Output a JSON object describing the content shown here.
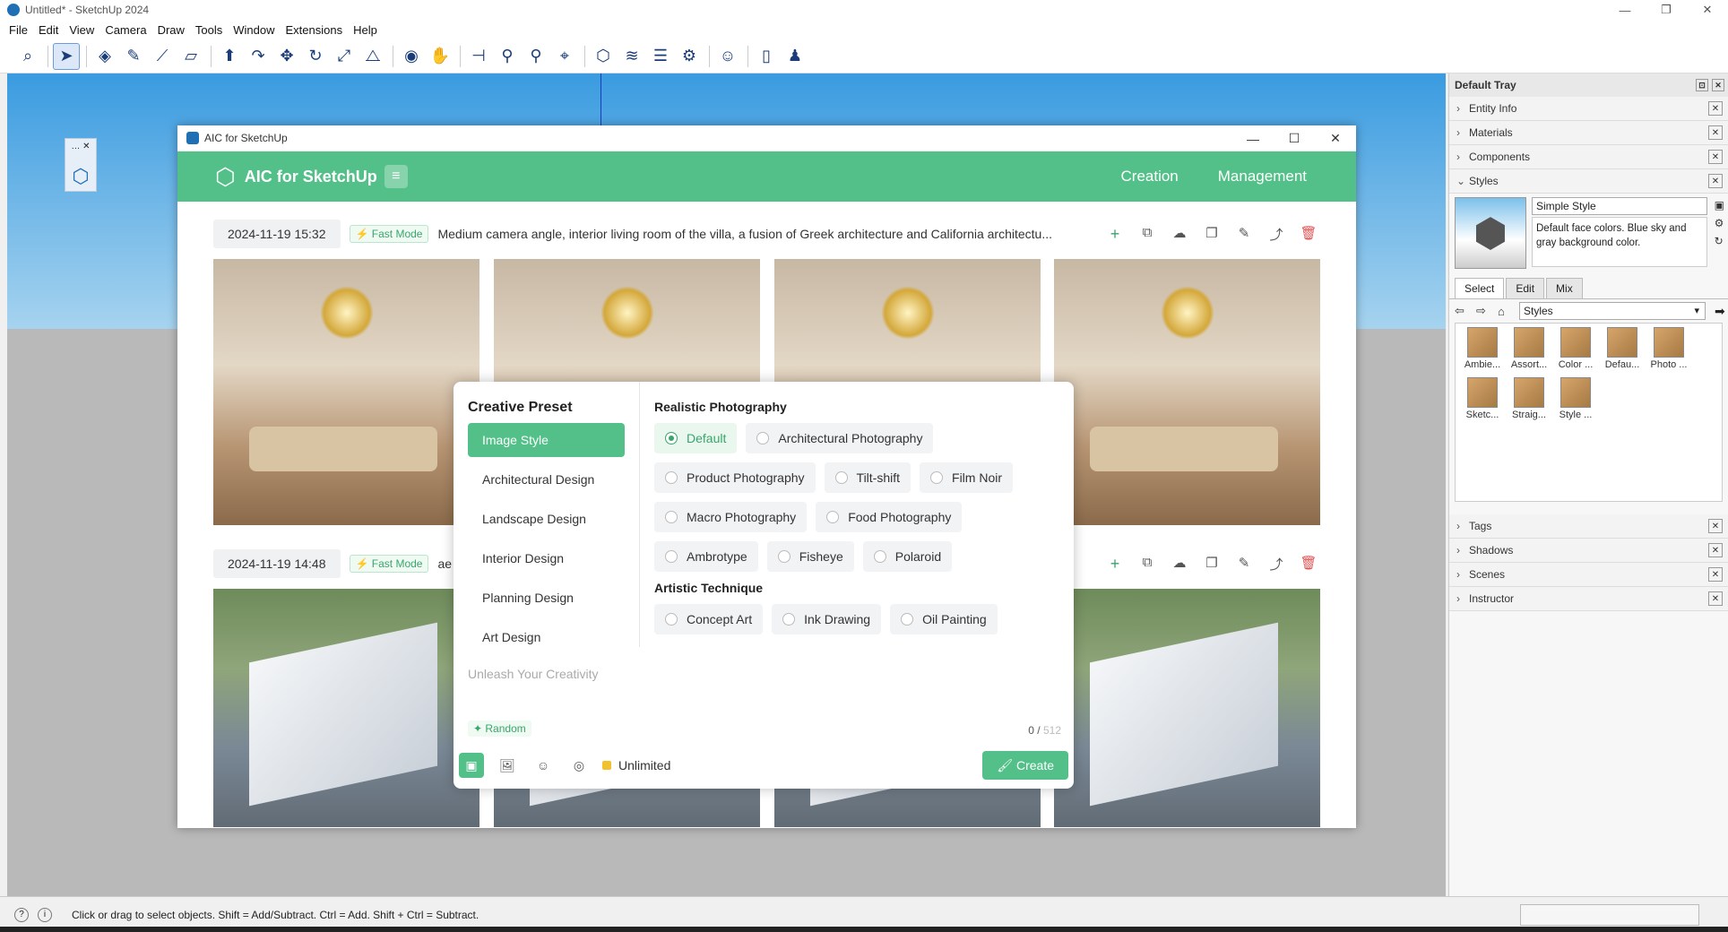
{
  "window": {
    "title": "Untitled* - SketchUp 2024",
    "minimize": "—",
    "restore": "❐",
    "close": "✕"
  },
  "menu": [
    "File",
    "Edit",
    "View",
    "Camera",
    "Draw",
    "Tools",
    "Window",
    "Extensions",
    "Help"
  ],
  "toolbar_icons": [
    "zoom-extents",
    "select",
    "eraser",
    "pencil",
    "line",
    "shape",
    "push-pull",
    "follow-me",
    "move",
    "rotate",
    "scale",
    "flip",
    "orbit",
    "pan",
    "section-plane",
    "walk",
    "look-around",
    "zoom",
    "zoom-window",
    "components",
    "styles",
    "layers",
    "scenes",
    "account",
    "new",
    "add-user"
  ],
  "aic": {
    "window_title": "AIC for SketchUp",
    "brand": "AIC for SketchUp",
    "menu_icon": "≡",
    "nav": [
      "Creation",
      "Management"
    ],
    "rows": [
      {
        "date": "2024-11-19 15:32",
        "mode": "⚡ Fast Mode",
        "prompt": "Medium camera angle, interior living room of the villa, a fusion of Greek architecture and California architectu..."
      },
      {
        "date": "2024-11-19 14:48",
        "mode": "⚡ Fast Mode",
        "prompt": "ae"
      }
    ],
    "row_actions": [
      "+",
      "⧉",
      "☁",
      "❐",
      "✎",
      "⤴",
      "🗑"
    ],
    "preset": {
      "title": "Creative Preset",
      "categories": [
        "Image Style",
        "Architectural Design",
        "Landscape Design",
        "Interior Design",
        "Planning Design",
        "Art Design"
      ],
      "groups": [
        {
          "title": "Realistic Photography",
          "options": [
            "Default",
            "Architectural Photography",
            "Product Photography",
            "Tilt-shift",
            "Film Noir",
            "Macro Photography",
            "Food Photography",
            "Ambrotype",
            "Fisheye",
            "Polaroid"
          ],
          "selected": "Default"
        },
        {
          "title": "Artistic Technique",
          "options": [
            "Concept Art",
            "Ink Drawing",
            "Oil Painting"
          ]
        }
      ],
      "placeholder": "Unleash Your Creativity",
      "random": "✦ Random",
      "count": "0 /",
      "max": "512",
      "quota": "Unlimited",
      "create": "🖌 Create"
    }
  },
  "tray": {
    "title": "Default Tray",
    "top_sections": [
      "Entity Info",
      "Materials",
      "Components",
      "Styles"
    ],
    "style_name": "Simple Style",
    "style_desc": "Default face colors. Blue sky and gray background color.",
    "tabs": [
      "Select",
      "Edit",
      "Mix"
    ],
    "collection": "Styles",
    "styles": [
      "Ambie...",
      "Assort...",
      "Color ...",
      "Defau...",
      "Photo ...",
      "Sketc...",
      "Straig...",
      "Style ..."
    ],
    "bottom_sections": [
      "Tags",
      "Shadows",
      "Scenes",
      "Instructor"
    ]
  },
  "status": {
    "text": "Click or drag to select objects. Shift = Add/Subtract. Ctrl = Add. Shift + Ctrl = Subtract."
  },
  "colors": {
    "accent": "#52c088",
    "sky": "#3a9be0",
    "ground": "#b9b9b9"
  }
}
